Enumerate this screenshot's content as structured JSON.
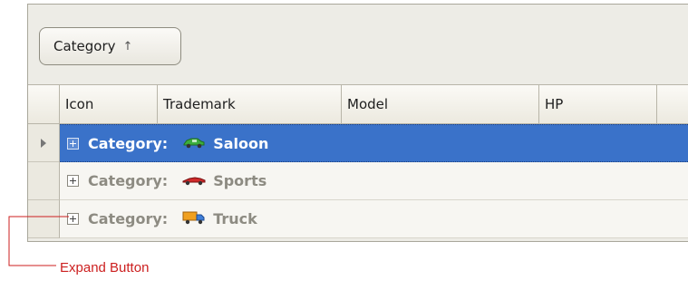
{
  "group_panel": {
    "chip_label": "Category",
    "chip_sort": "↑"
  },
  "columns": [
    "Icon",
    "Trademark",
    "Model",
    "HP"
  ],
  "group_rows": [
    {
      "prefix": "Category:",
      "value": "Saloon",
      "icon": "saloon-car-icon",
      "selected": true
    },
    {
      "prefix": "Category:",
      "value": "Sports",
      "icon": "sports-car-icon",
      "selected": false
    },
    {
      "prefix": "Category:",
      "value": "Truck",
      "icon": "truck-icon",
      "selected": false
    }
  ],
  "callout": {
    "label": "Expand Button",
    "color": "#cc1f1f"
  },
  "colors": {
    "selection": "#3a72c9",
    "grid_bg": "#edece6"
  }
}
